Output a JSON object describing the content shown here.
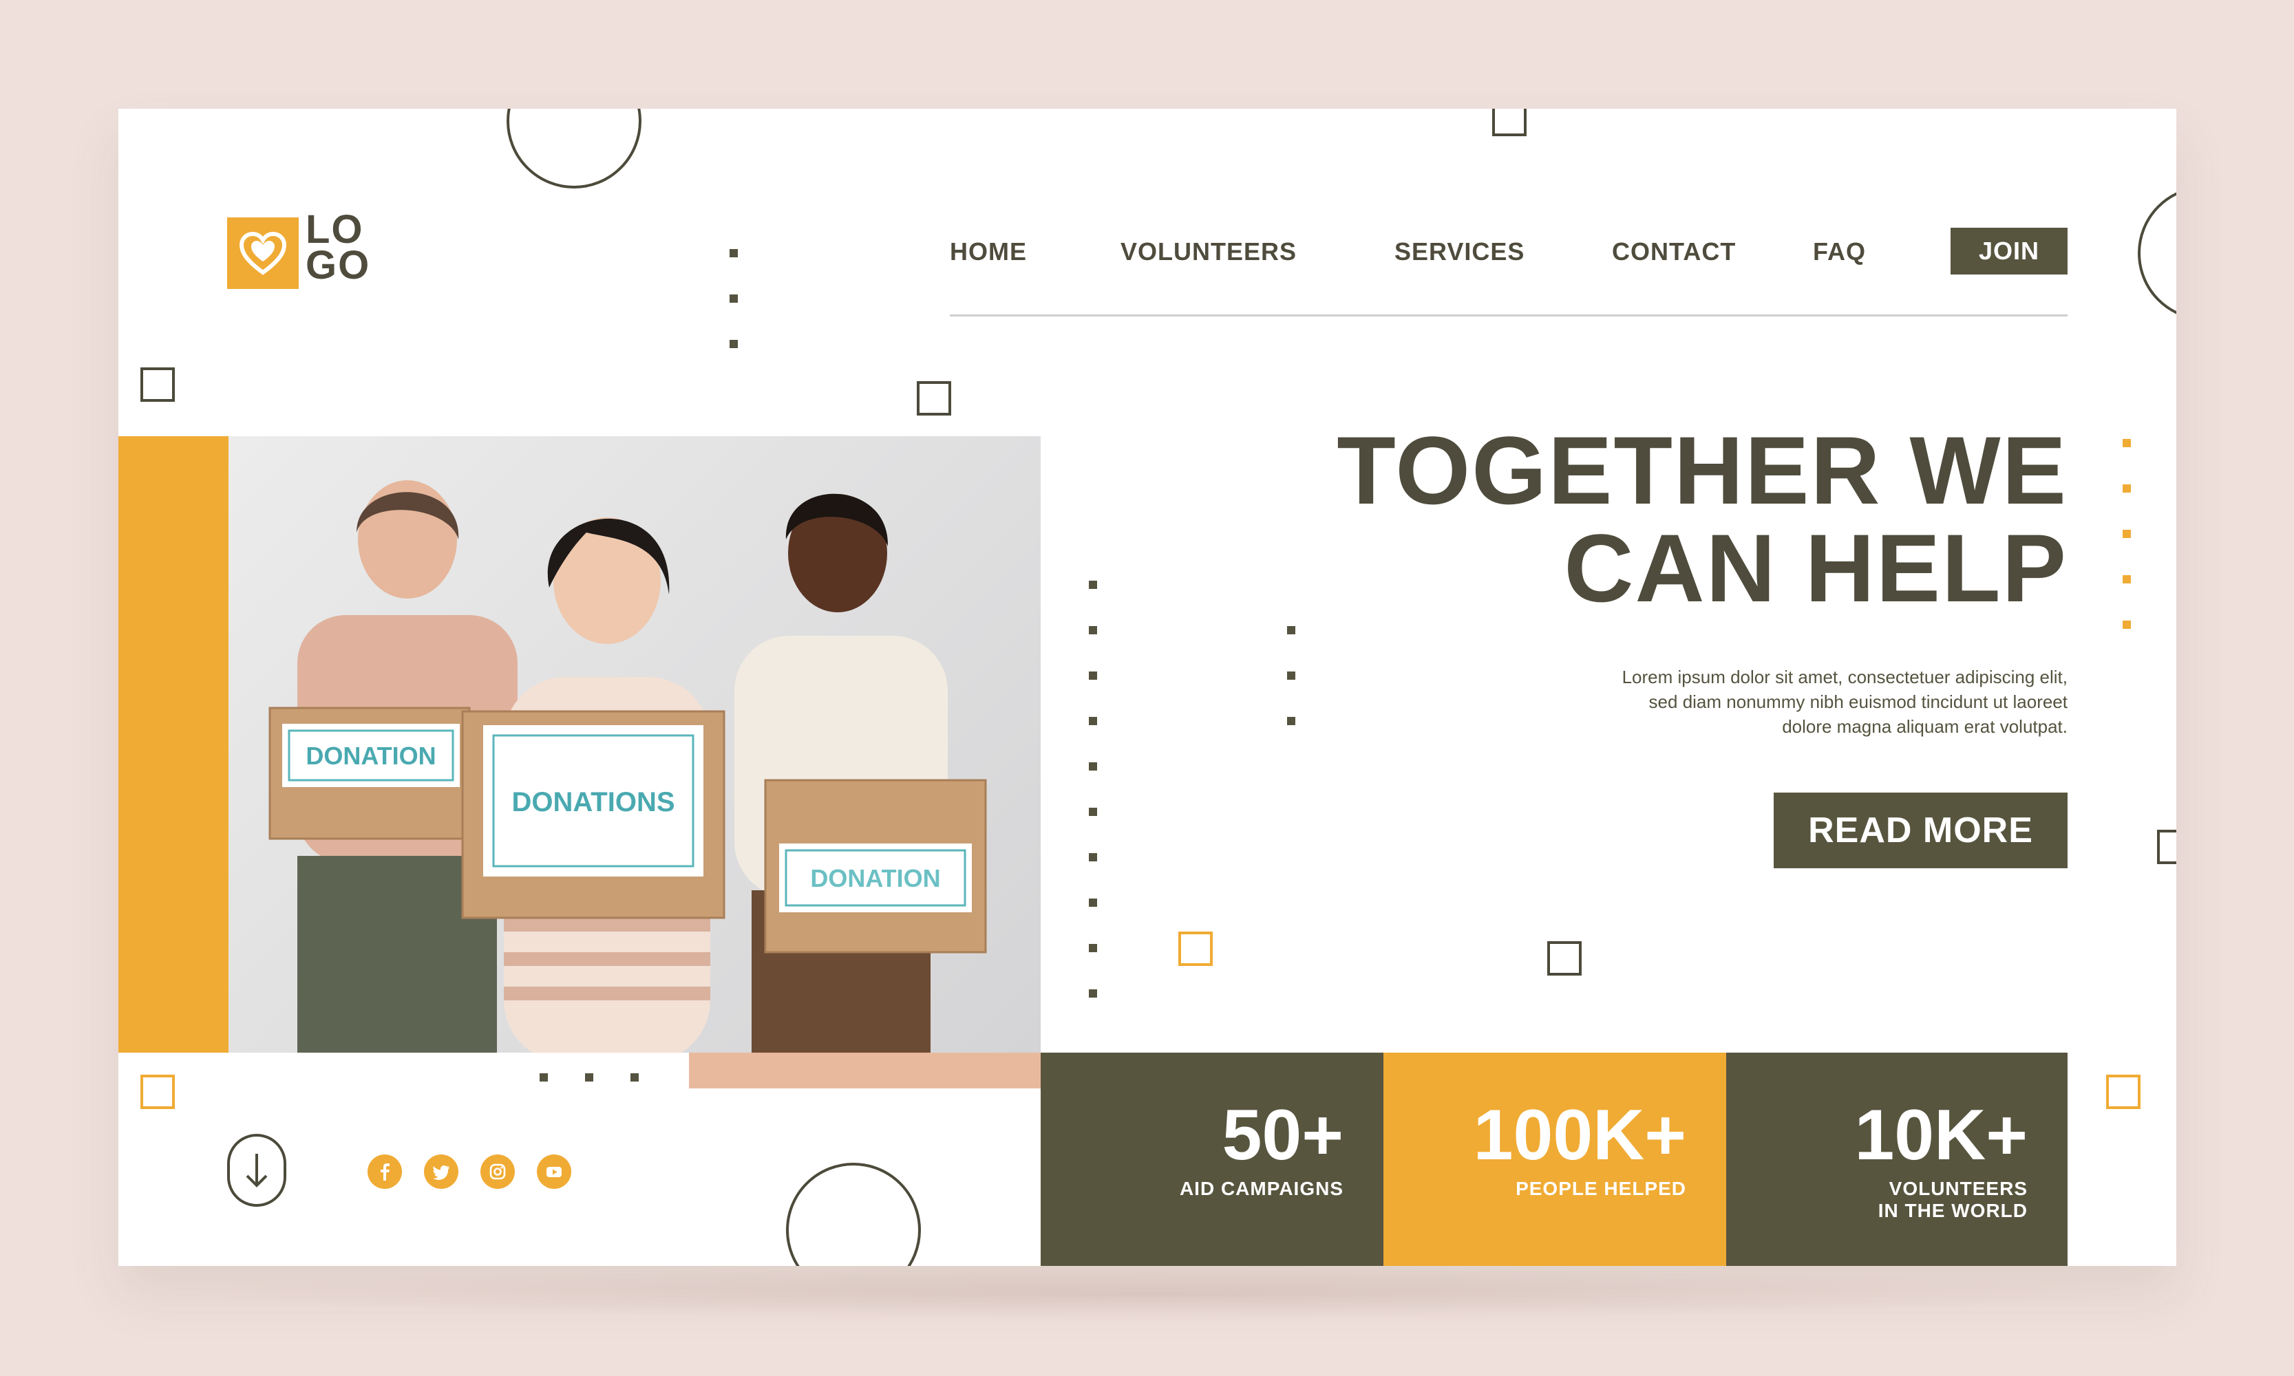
{
  "brand": {
    "logo_line1": "LO",
    "logo_line2": "GO",
    "icon": "heart-icon",
    "accent_color": "#f0ab34",
    "dark_color": "#58553f"
  },
  "nav": {
    "items": [
      {
        "label": "HOME"
      },
      {
        "label": "VOLUNTEERS"
      },
      {
        "label": "SERVICES"
      },
      {
        "label": "CONTACT"
      },
      {
        "label": "FAQ"
      }
    ],
    "join_label": "JOIN"
  },
  "hero": {
    "title_line1": "TOGETHER WE",
    "title_line2": "CAN HELP",
    "body_line1": "Lorem ipsum dolor sit amet, consectetuer adipiscing elit,",
    "body_line2": "sed diam nonummy nibh euismod tincidunt ut laoreet",
    "body_line3": "dolore magna aliquam erat volutpat.",
    "cta_label": "READ MORE"
  },
  "photo": {
    "box_labels": [
      "DONATION",
      "DONATIONS",
      "DONATION"
    ]
  },
  "stats": [
    {
      "value": "50+",
      "label_line1": "AID CAMPAIGNS",
      "label_line2": ""
    },
    {
      "value": "100K+",
      "label_line1": "PEOPLE HELPED",
      "label_line2": ""
    },
    {
      "value": "10K+",
      "label_line1": "VOLUNTEERS",
      "label_line2": "IN THE WORLD"
    }
  ],
  "social": [
    "facebook-icon",
    "twitter-icon",
    "instagram-icon",
    "youtube-icon"
  ],
  "scroll_icon": "arrow-down-icon"
}
